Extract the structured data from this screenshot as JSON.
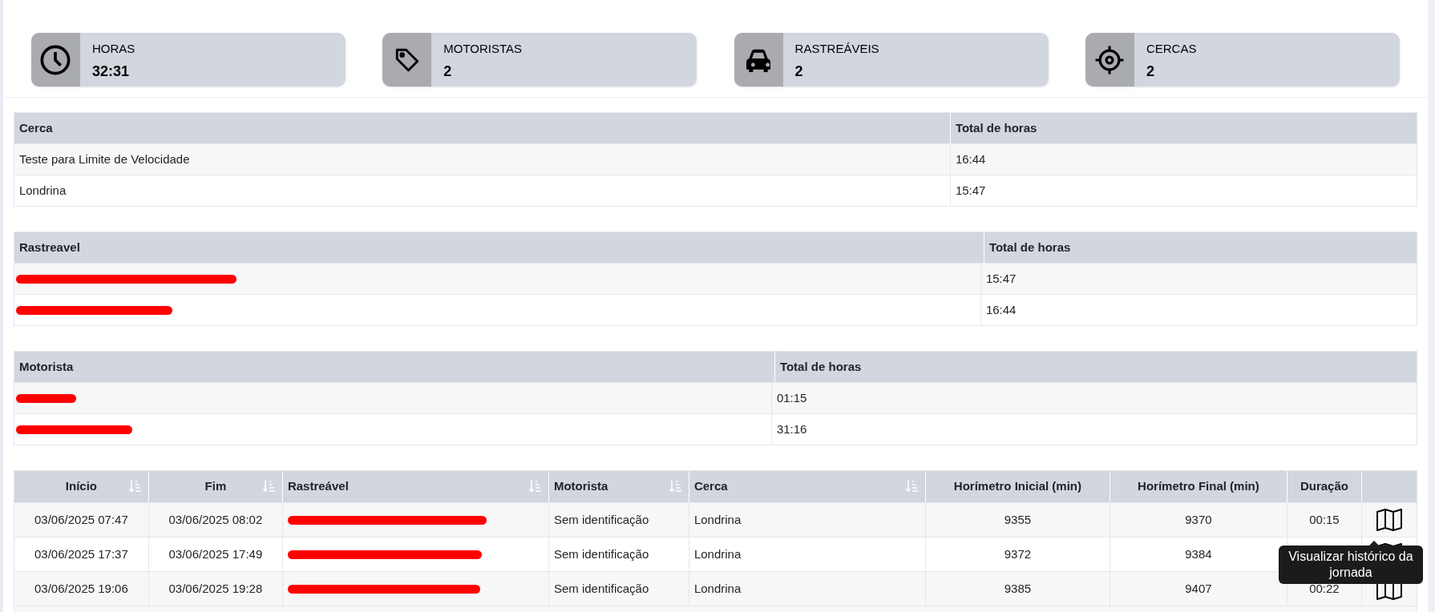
{
  "stats": [
    {
      "label": "HORAS",
      "value": "32:31"
    },
    {
      "label": "MOTORISTAS",
      "value": "2"
    },
    {
      "label": "RASTREÁVEIS",
      "value": "2"
    },
    {
      "label": "CERCAS",
      "value": "2"
    }
  ],
  "summary_tables": [
    {
      "columns": [
        "Cerca",
        "Total de horas"
      ],
      "rows": [
        {
          "name": "Teste para Limite de Velocidade",
          "redacted": false,
          "total": "16:44"
        },
        {
          "name": "Londrina",
          "redacted": false,
          "total": "15:47"
        }
      ]
    },
    {
      "columns": [
        "Rastreavel",
        "Total de horas"
      ],
      "rows": [
        {
          "redacted": true,
          "total": "15:47"
        },
        {
          "redacted": true,
          "total": "16:44"
        }
      ]
    },
    {
      "columns": [
        "Motorista",
        "Total de horas"
      ],
      "rows": [
        {
          "redacted": true,
          "total": "01:15"
        },
        {
          "redacted": true,
          "total": "31:16"
        }
      ]
    }
  ],
  "trips": {
    "columns": [
      {
        "label": "Início",
        "sortable": true
      },
      {
        "label": "Fim",
        "sortable": true
      },
      {
        "label": "Rastreável",
        "sortable": true
      },
      {
        "label": "Motorista",
        "sortable": true
      },
      {
        "label": "Cerca",
        "sortable": true
      },
      {
        "label": "Horímetro Inicial (min)",
        "sortable": false
      },
      {
        "label": "Horímetro Final (min)",
        "sortable": false
      },
      {
        "label": "Duração",
        "sortable": false
      }
    ],
    "rows": [
      {
        "inicio": "03/06/2025 07:47",
        "fim": "03/06/2025 08:02",
        "motorista": "Sem identificação",
        "cerca": "Londrina",
        "h_ini": "9355",
        "h_fim": "9370",
        "duracao": "00:15"
      },
      {
        "inicio": "03/06/2025 17:37",
        "fim": "03/06/2025 17:49",
        "motorista": "Sem identificação",
        "cerca": "Londrina",
        "h_ini": "9372",
        "h_fim": "9384"
      },
      {
        "inicio": "03/06/2025 19:06",
        "fim": "03/06/2025 19:28",
        "motorista": "Sem identificação",
        "cerca": "Londrina",
        "h_ini": "9385",
        "h_fim": "9407",
        "duracao": "00:22"
      }
    ],
    "tooltip": "Visualizar histórico da jornada"
  }
}
